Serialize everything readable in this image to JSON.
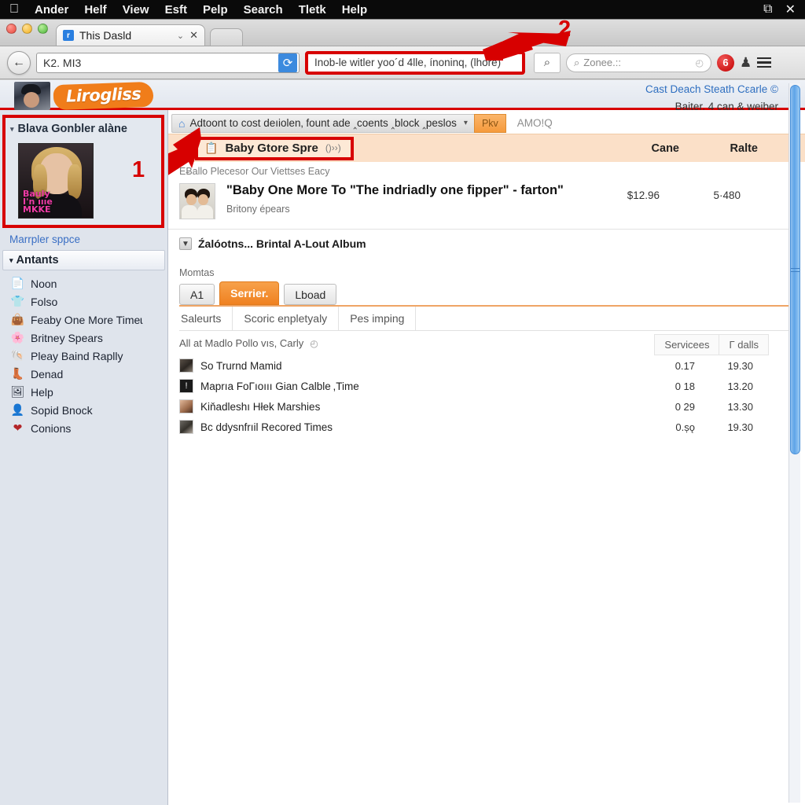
{
  "os_menu": {
    "apple_glyph": "",
    "items": [
      "Ander",
      "Helf",
      "View",
      "Esft",
      "Pelp",
      "Search",
      "Tletk",
      "Help"
    ],
    "right_icons": [
      {
        "name": "display-mirror-icon",
        "glyph": "⧉"
      },
      {
        "name": "close-icon",
        "glyph": "✕"
      }
    ]
  },
  "browser": {
    "tab": {
      "favicon_letter": "r",
      "title": "This Dasld",
      "chevron_glyph": "⌄",
      "close_glyph": "✕"
    },
    "toolbar": {
      "back_glyph": "←",
      "url_value": "K2. MI3",
      "reload_glyph": "⟳",
      "search_value": "Inob-le witler yoo´d 4lle, ínoninq, (lhore)",
      "search_go_glyph": "⌕",
      "site_search_placeholder": "Zonee.::",
      "site_search_icon_glyph": "⌕",
      "history_clock_glyph": "◴",
      "opera_letter": "6",
      "user_glyph": "♟",
      "menu_name": "hamburger-menu"
    }
  },
  "annotations": [
    {
      "label": "1",
      "target": "sidebar-featured-box"
    },
    {
      "label": "2",
      "target": "search-field"
    }
  ],
  "site_header": {
    "logo_text": "Lirogliss",
    "right_link": "Cast Deach Steath Cεarle ©",
    "right_sub": "Baiter, 4 can & weiber"
  },
  "sidebar": {
    "featured": {
      "heading": "Blava Gonbler alàne",
      "triangle": "▾",
      "album_art_text": "Bauly\nI'n ıııe\nMKKE"
    },
    "link": "Marrpler sppce",
    "section": {
      "triangle": "▾",
      "label": "Antants"
    },
    "items": [
      {
        "icon": "document-icon",
        "glyph": "📄",
        "label": "Noon"
      },
      {
        "icon": "shirt-icon",
        "glyph": "👕",
        "label": "Folso"
      },
      {
        "icon": "bag-icon",
        "glyph": "👜",
        "label": "Feaby One More Timeɩ"
      },
      {
        "icon": "flower-icon",
        "glyph": "🌸",
        "label": "Britney Spears"
      },
      {
        "icon": "fish-icon",
        "glyph": "🐚",
        "label": "Pleay Baind Raplly"
      },
      {
        "icon": "shoe-icon",
        "glyph": "👢",
        "label": "Denad"
      },
      {
        "icon": "picture-icon",
        "glyph": "🖼",
        "label": "Help"
      },
      {
        "icon": "person-icon",
        "glyph": "👤",
        "label": "Sopid Bnock"
      },
      {
        "icon": "heart-icon",
        "glyph": "❤",
        "label": "Conions"
      }
    ]
  },
  "main": {
    "breadcrumb": {
      "home_glyph": "⌂",
      "text": "Adtoont to cost deıiolen‚ fount ade ‸coents ‸block ‸peslos",
      "caret": "▾"
    },
    "play_button": "Pkv",
    "amo_label": "AMO!Q",
    "highlight_row": {
      "left_icon": "🌻",
      "folder_glyph": "📋",
      "title": "Baby Gtore Spre",
      "arrows": "()››)",
      "col_a": "Cane",
      "col_b": "Ralte"
    },
    "subnote": "EɃallo Plecesor Our Viettses Eacy",
    "product": {
      "title": "\"Baby One More To  \"The indriadly one fipper\"  - farton\"",
      "artist": "Britony épears",
      "price": "$12.96",
      "number": "5·480"
    },
    "album_line": {
      "icon_glyph": "▼",
      "text": "Źalóotns... Brintal A-Lout Album"
    },
    "momtas_label": "Momtas",
    "buttons": [
      {
        "label": "A1",
        "active": false
      },
      {
        "label": "Serrier.",
        "active": true
      },
      {
        "label": "Lboad",
        "active": false
      }
    ],
    "subtabs": [
      "Saleurts",
      "Scoric enpletyaly",
      "Pes imping"
    ],
    "list_header": {
      "text": "All at Madlo Pollo vıs, Carly",
      "clock_glyph": "◴",
      "buttons": [
        "Servicees",
        "Γ dalls"
      ]
    },
    "tracks": [
      {
        "name": "So Trurnd Mamid",
        "col1": "0.17",
        "col2": "19.30"
      },
      {
        "name": "Maprıa FoΓıoııı Gian Calble ,Time",
        "col1": "0 18",
        "col2": "13.20"
      },
      {
        "name": "Kiňadleshı Hłek Marshies",
        "col1": "0 29",
        "col2": "13.30"
      },
      {
        "name": "Bc ddysnfrıil Recored Times",
        "col1": "0.șǫ",
        "col2": "19.30"
      }
    ]
  },
  "colors": {
    "annotation_red": "#d70000",
    "accent_orange": "#ef8121",
    "highlight_bg": "#fbe0c8",
    "link_blue": "#3a6fc4",
    "scrollbar_blue": "#5ea4e8"
  }
}
